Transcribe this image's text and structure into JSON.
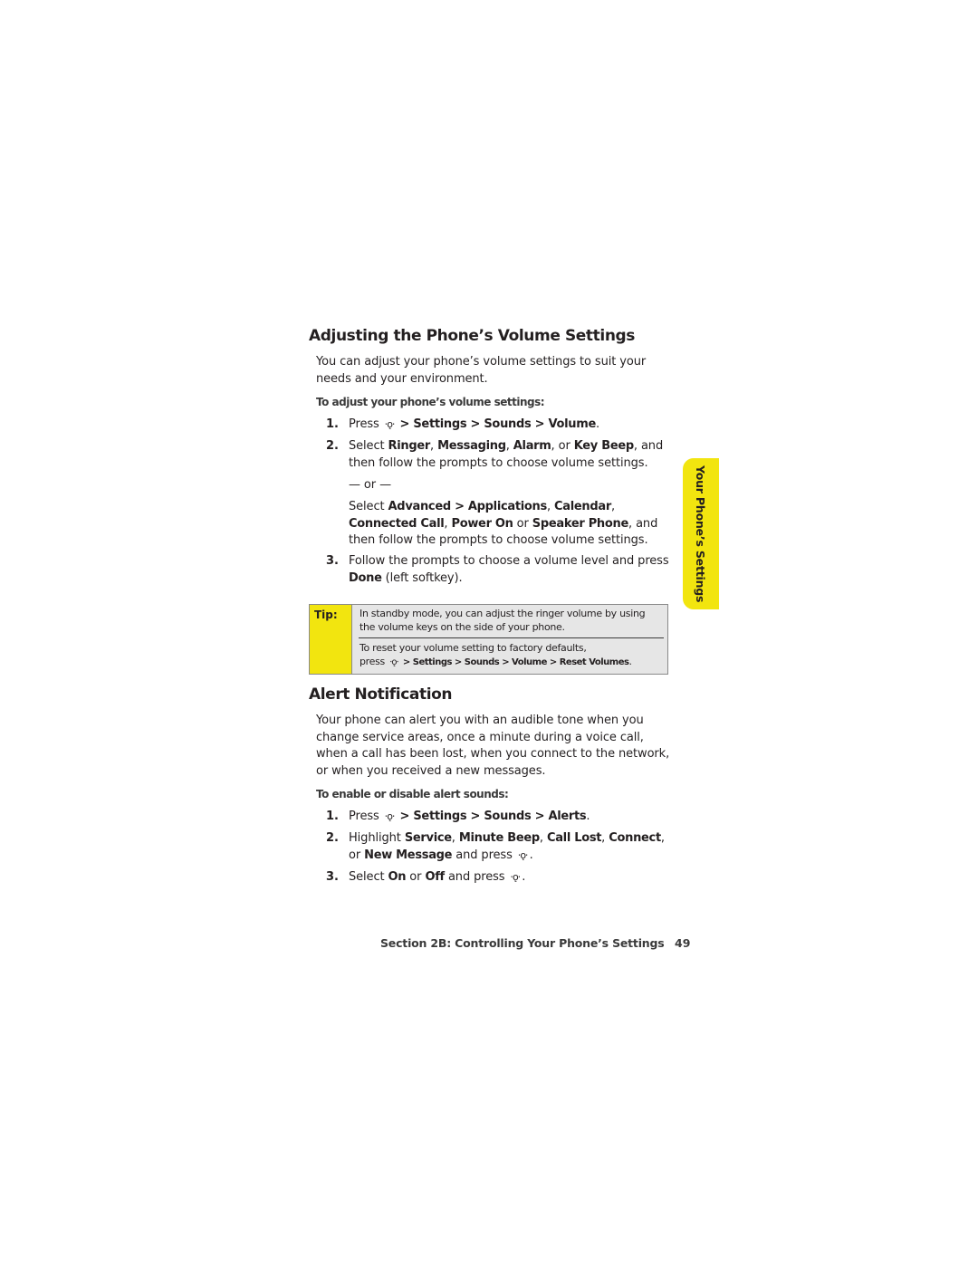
{
  "icons": {
    "nav_key": "⋅ǫ⋅"
  },
  "volume_section": {
    "title": "Adjusting the Phone’s Volume Settings",
    "intro": "You can adjust your phone’s volume settings to suit your needs and your environment.",
    "procedure_heading": "To adjust your phone’s volume settings:",
    "steps": [
      {
        "num": "1.",
        "press": "Press",
        "path": "> Settings > Sounds > Volume",
        "end": "."
      },
      {
        "num": "2.",
        "pre": "Select ",
        "b1": "Ringer",
        "s1": ", ",
        "b2": "Messaging",
        "s2": ", ",
        "b3": "Alarm",
        "s3": ", or ",
        "b4": "Key Beep",
        "post": ", and then follow the prompts to choose volume settings."
      },
      {
        "num": "3.",
        "pre": "Follow the prompts to choose a volume level and press ",
        "b1": "Done",
        "post": " (left softkey)."
      }
    ],
    "or_separator": "— or —",
    "alt": {
      "pre": "Select ",
      "b1": "Advanced > Applications",
      "s1": ", ",
      "b2": "Calendar",
      "s2": ", ",
      "b3": "Connected Call",
      "s3": ", ",
      "b4": "Power On",
      "s4": " or ",
      "b5": "Speaker Phone",
      "post": ", and then follow the prompts to choose volume settings."
    }
  },
  "tip": {
    "label": "Tip:",
    "text1": "In standby mode, you can adjust the ringer volume by using the volume keys on the side of your phone.",
    "text2_pre": "To reset your volume setting to factory defaults,",
    "text2_press": "press",
    "text2_path": "> Settings > Sounds > Volume > Reset Volumes",
    "text2_end": "."
  },
  "alert_section": {
    "title": "Alert Notification",
    "intro": "Your phone can alert you with an audible tone when you change service areas, once a minute during a voice call, when a call has been lost, when you connect to the network, or when you received a new messages.",
    "procedure_heading": "To enable or disable alert sounds:",
    "steps": [
      {
        "num": "1.",
        "press": "Press",
        "path": "> Settings > Sounds > Alerts",
        "end": "."
      },
      {
        "num": "2.",
        "pre": "Highlight ",
        "b1": "Service",
        "s1": ", ",
        "b2": "Minute Beep",
        "s2": ", ",
        "b3": "Call Lost",
        "s3": ", ",
        "b4": "Connect",
        "s4": ", or ",
        "b5": "New Message",
        "post": " and press",
        "end": "."
      },
      {
        "num": "3.",
        "pre": "Select ",
        "b1": "On",
        "s1": " or ",
        "b2": "Off",
        "post": " and press",
        "end": "."
      }
    ]
  },
  "side_tab": {
    "label": "Your Phone’s Settings",
    "color": "#f2e50f"
  },
  "footer": {
    "section": "Section 2B: Controlling Your Phone’s Settings",
    "page_number": "49"
  }
}
